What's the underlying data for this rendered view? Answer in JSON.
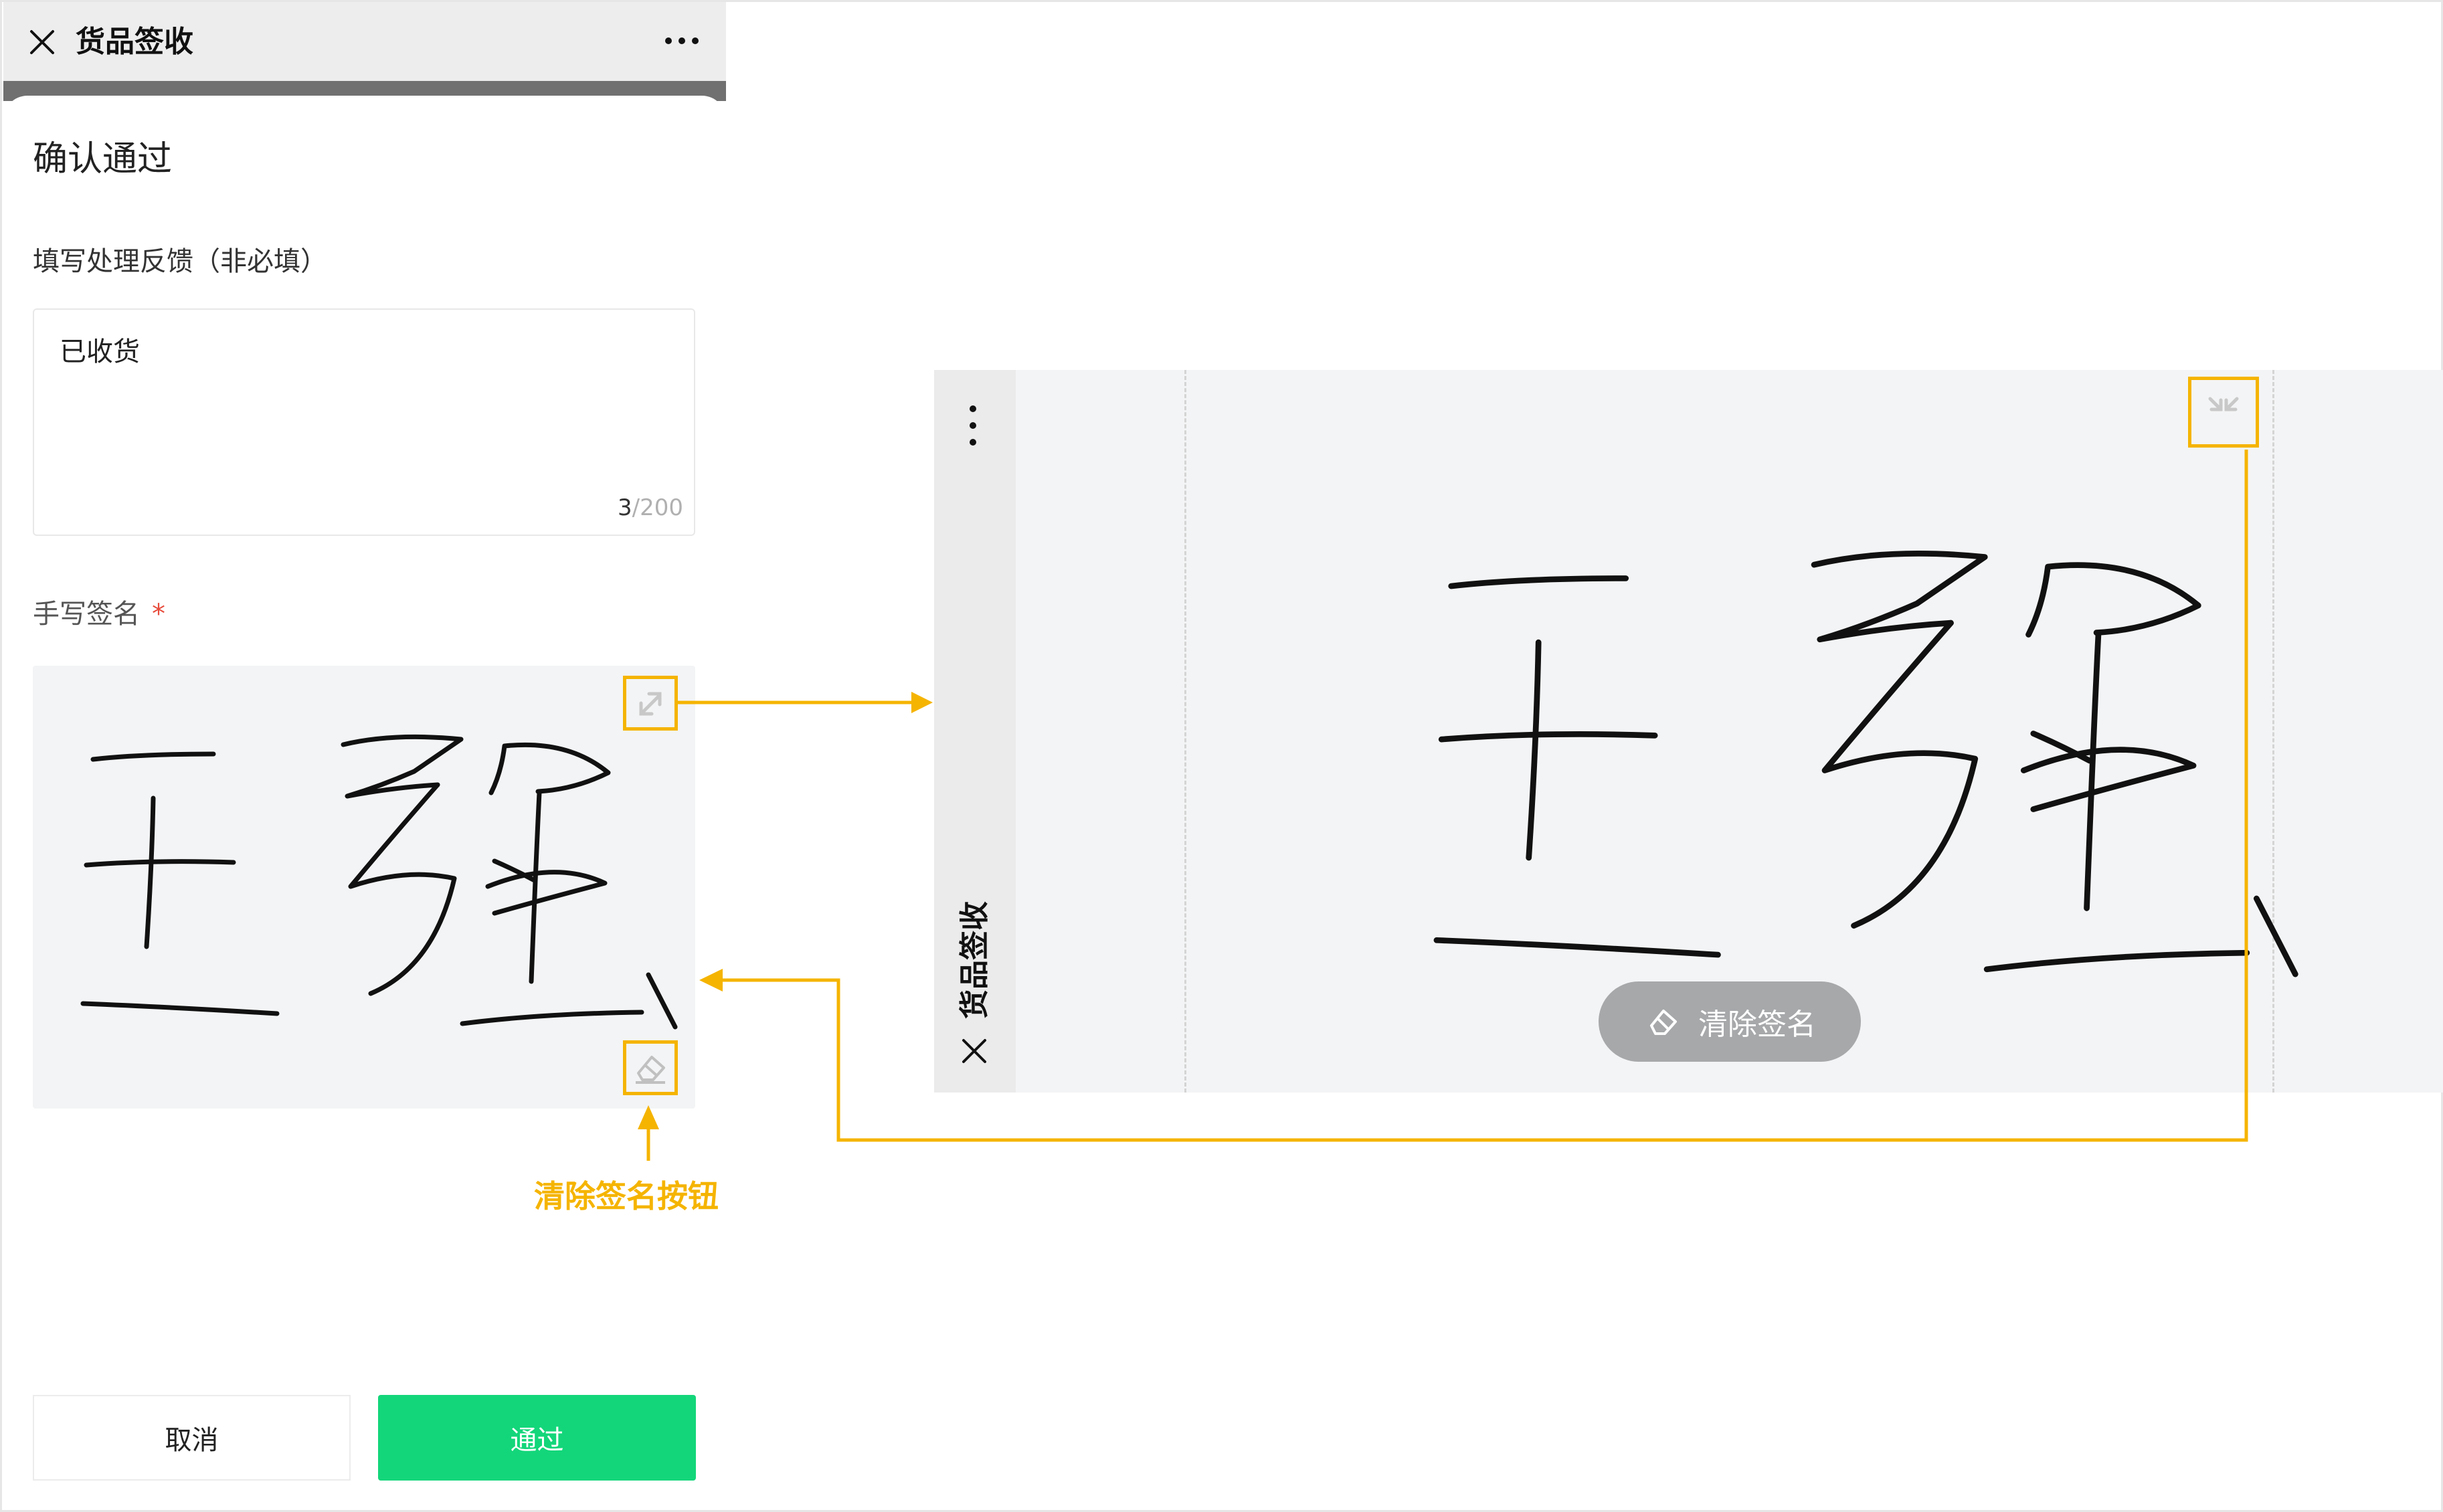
{
  "colors": {
    "accent_green": "#13d67a",
    "annotation": "#f5b400",
    "required_star": "#e74c3c"
  },
  "nav": {
    "title": "货品签收",
    "close_icon": "close-icon",
    "more_icon": "more-icon"
  },
  "dialog": {
    "title": "确认通过",
    "feedback_label": "填写处理反馈（非必填）",
    "feedback_value": "已收货",
    "counter_current": "3",
    "counter_max": "/200",
    "signature_label": "手写签名",
    "required_mark": "*",
    "cancel_label": "取消",
    "pass_label": "通过"
  },
  "annotation": {
    "clear_button_label": "清除签名按钮"
  },
  "landscape": {
    "title": "货品签收",
    "clear_label": "清除签名"
  }
}
